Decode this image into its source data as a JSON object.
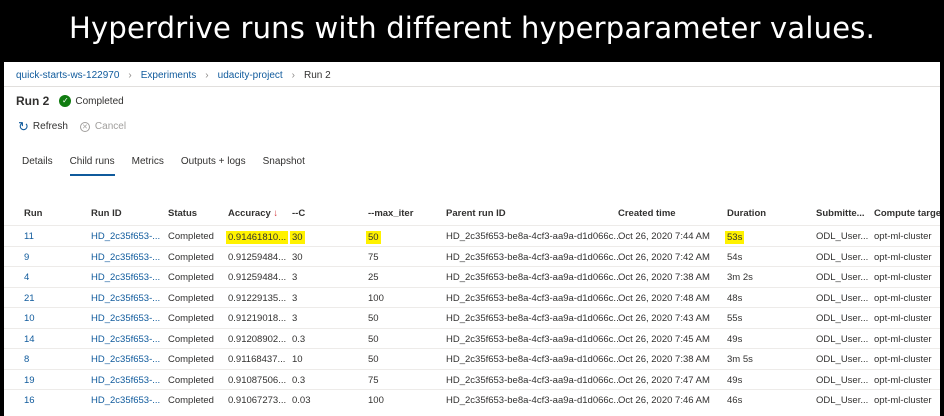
{
  "banner": {
    "title": "Hyperdrive runs with different hyperparameter values."
  },
  "breadcrumb": {
    "workspace": "quick-starts-ws-122970",
    "experiments": "Experiments",
    "experiment": "udacity-project",
    "run": "Run 2"
  },
  "run": {
    "title": "Run 2",
    "status": "Completed"
  },
  "toolbar": {
    "refresh": "Refresh",
    "cancel": "Cancel"
  },
  "tabs": [
    "Details",
    "Child runs",
    "Metrics",
    "Outputs + logs",
    "Snapshot"
  ],
  "table": {
    "headers": {
      "run": "Run",
      "run_id": "Run ID",
      "status": "Status",
      "accuracy": "Accuracy",
      "c": "--C",
      "max_iter": "--max_iter",
      "parent": "Parent run ID",
      "created": "Created time",
      "duration": "Duration",
      "submitted": "Submitte...",
      "compute": "Compute target"
    },
    "rows": [
      {
        "run": "11",
        "run_id": "HD_2c35f653-...",
        "status": "Completed",
        "accuracy": "0.91461810...",
        "c": "30",
        "max_iter": "50",
        "parent": "HD_2c35f653-be8a-4cf3-aa9a-d1d066c...",
        "created": "Oct 26, 2020 7:44 AM",
        "duration": "53s",
        "submitted": "ODL_User...",
        "compute": "opt-ml-cluster"
      },
      {
        "run": "9",
        "run_id": "HD_2c35f653-...",
        "status": "Completed",
        "accuracy": "0.91259484...",
        "c": "30",
        "max_iter": "75",
        "parent": "HD_2c35f653-be8a-4cf3-aa9a-d1d066c...",
        "created": "Oct 26, 2020 7:42 AM",
        "duration": "54s",
        "submitted": "ODL_User...",
        "compute": "opt-ml-cluster"
      },
      {
        "run": "4",
        "run_id": "HD_2c35f653-...",
        "status": "Completed",
        "accuracy": "0.91259484...",
        "c": "3",
        "max_iter": "25",
        "parent": "HD_2c35f653-be8a-4cf3-aa9a-d1d066c...",
        "created": "Oct 26, 2020 7:38 AM",
        "duration": "3m 2s",
        "submitted": "ODL_User...",
        "compute": "opt-ml-cluster"
      },
      {
        "run": "21",
        "run_id": "HD_2c35f653-...",
        "status": "Completed",
        "accuracy": "0.91229135...",
        "c": "3",
        "max_iter": "100",
        "parent": "HD_2c35f653-be8a-4cf3-aa9a-d1d066c...",
        "created": "Oct 26, 2020 7:48 AM",
        "duration": "48s",
        "submitted": "ODL_User...",
        "compute": "opt-ml-cluster"
      },
      {
        "run": "10",
        "run_id": "HD_2c35f653-...",
        "status": "Completed",
        "accuracy": "0.91219018...",
        "c": "3",
        "max_iter": "50",
        "parent": "HD_2c35f653-be8a-4cf3-aa9a-d1d066c...",
        "created": "Oct 26, 2020 7:43 AM",
        "duration": "55s",
        "submitted": "ODL_User...",
        "compute": "opt-ml-cluster"
      },
      {
        "run": "14",
        "run_id": "HD_2c35f653-...",
        "status": "Completed",
        "accuracy": "0.91208902...",
        "c": "0.3",
        "max_iter": "50",
        "parent": "HD_2c35f653-be8a-4cf3-aa9a-d1d066c...",
        "created": "Oct 26, 2020 7:45 AM",
        "duration": "49s",
        "submitted": "ODL_User...",
        "compute": "opt-ml-cluster"
      },
      {
        "run": "8",
        "run_id": "HD_2c35f653-...",
        "status": "Completed",
        "accuracy": "0.91168437...",
        "c": "10",
        "max_iter": "50",
        "parent": "HD_2c35f653-be8a-4cf3-aa9a-d1d066c...",
        "created": "Oct 26, 2020 7:38 AM",
        "duration": "3m 5s",
        "submitted": "ODL_User...",
        "compute": "opt-ml-cluster"
      },
      {
        "run": "19",
        "run_id": "HD_2c35f653-...",
        "status": "Completed",
        "accuracy": "0.91087506...",
        "c": "0.3",
        "max_iter": "75",
        "parent": "HD_2c35f653-be8a-4cf3-aa9a-d1d066c...",
        "created": "Oct 26, 2020 7:47 AM",
        "duration": "49s",
        "submitted": "ODL_User...",
        "compute": "opt-ml-cluster"
      },
      {
        "run": "16",
        "run_id": "HD_2c35f653-...",
        "status": "Completed",
        "accuracy": "0.91067273...",
        "c": "0.03",
        "max_iter": "100",
        "parent": "HD_2c35f653-be8a-4cf3-aa9a-d1d066c...",
        "created": "Oct 26, 2020 7:46 AM",
        "duration": "46s",
        "submitted": "ODL_User...",
        "compute": "opt-ml-cluster"
      }
    ]
  },
  "icons": {
    "status": "checkmark-circle-icon",
    "refresh": "refresh-icon",
    "cancel": "cancel-circle-icon",
    "sort": "sort-descending-icon",
    "breadcrumb_separator": "chevron-right-icon"
  },
  "colors": {
    "link": "#0f5a9c",
    "success": "#107c10",
    "highlight": "#fff200",
    "sort": "#d13438"
  }
}
